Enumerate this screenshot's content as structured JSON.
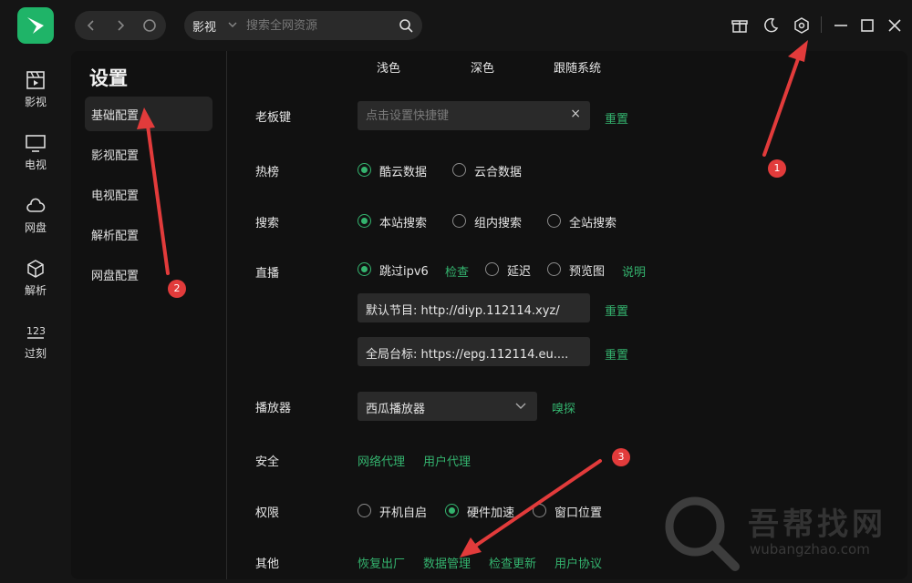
{
  "app": {
    "accent": "#34b36e",
    "logo_color": "#1fb468"
  },
  "topbar": {
    "search_category": "影视",
    "search_placeholder": "搜索全网资源",
    "icons": [
      "back-icon",
      "forward-icon",
      "refresh-icon",
      "gift-icon",
      "moon-icon",
      "settings-icon",
      "minimize-icon",
      "maximize-icon",
      "close-icon"
    ]
  },
  "rail": {
    "items": [
      {
        "label": "影视",
        "icon": "clapperboard-icon"
      },
      {
        "label": "电视",
        "icon": "tv-icon"
      },
      {
        "label": "网盘",
        "icon": "cloud-icon"
      },
      {
        "label": "解析",
        "icon": "cube-icon"
      },
      {
        "label": "过刻",
        "icon": "numbers-icon"
      }
    ]
  },
  "settings": {
    "title": "设置",
    "nav": [
      {
        "label": "基础配置",
        "active": true
      },
      {
        "label": "影视配置"
      },
      {
        "label": "电视配置"
      },
      {
        "label": "解析配置"
      },
      {
        "label": "网盘配置"
      }
    ]
  },
  "content": {
    "theme": {
      "options": [
        "浅色",
        "深色",
        "跟随系统"
      ]
    },
    "boss_key": {
      "label": "老板键",
      "placeholder": "点击设置快捷键",
      "clear": "×",
      "reset": "重置"
    },
    "hot": {
      "label": "热榜",
      "options": [
        "酷云数据",
        "云合数据"
      ],
      "selected": "酷云数据"
    },
    "search": {
      "label": "搜索",
      "options": [
        "本站搜索",
        "组内搜索",
        "全站搜索"
      ],
      "selected": "本站搜索"
    },
    "live": {
      "label": "直播",
      "skip_ipv6": "跳过ipv6",
      "check": "检查",
      "delay": "延迟",
      "preview": "预览图",
      "explain": "说明",
      "default_program": "默认节目: http://diyp.112114.xyz/",
      "global_epg": "全局台标: https://epg.112114.eu....",
      "reset": "重置"
    },
    "player": {
      "label": "播放器",
      "value": "西瓜播放器",
      "sniff": "嗅探"
    },
    "security": {
      "label": "安全",
      "links": [
        "网络代理",
        "用户代理"
      ]
    },
    "permission": {
      "label": "权限",
      "options": [
        "开机自启",
        "硬件加速",
        "窗口位置"
      ],
      "selected": "硬件加速"
    },
    "other": {
      "label": "其他",
      "links": [
        "恢复出厂",
        "数据管理",
        "检查更新",
        "用户协议"
      ]
    }
  },
  "annotations": {
    "badges": [
      "1",
      "2",
      "3"
    ],
    "color": "#e23b3b"
  },
  "watermark": {
    "text": "吾帮找网",
    "url": "wubangzhao.com"
  }
}
